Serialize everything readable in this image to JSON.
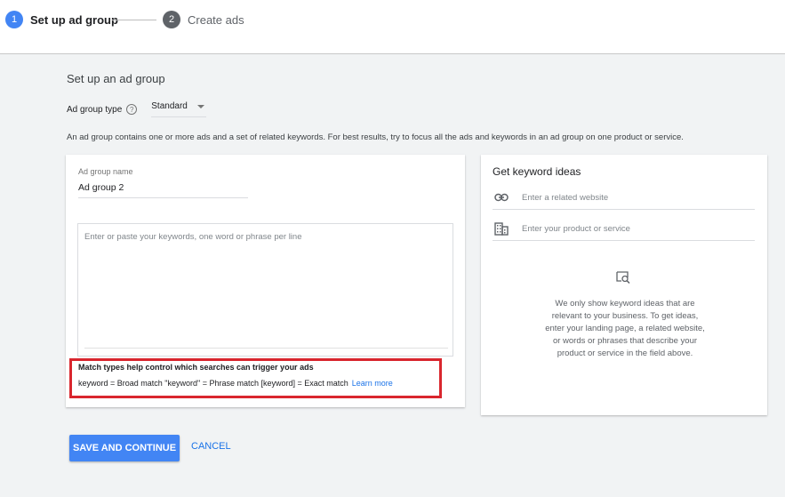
{
  "stepper": {
    "step1": {
      "number": "1",
      "label": "Set up ad group"
    },
    "step2": {
      "number": "2",
      "label": "Create ads"
    }
  },
  "section_title": "Set up an ad group",
  "ad_group_type": {
    "label": "Ad group type",
    "help": "?",
    "value": "Standard"
  },
  "description": "An ad group contains one or more ads and a set of related keywords. For best results, try to focus all the ads and keywords in an ad group on one product or service.",
  "ad_group_name": {
    "label": "Ad group name",
    "value": "Ad group 2"
  },
  "keywords": {
    "placeholder": "Enter or paste your keywords, one word or phrase per line"
  },
  "match_types": {
    "title": "Match types help control which searches can trigger your ads",
    "text": "keyword = Broad match  \"keyword\" = Phrase match  [keyword] = Exact match",
    "link": "Learn more"
  },
  "keyword_ideas": {
    "title": "Get keyword ideas",
    "website_placeholder": "Enter a related website",
    "product_placeholder": "Enter your product or service",
    "info": "We only show keyword ideas that are relevant to your business. To get ideas, enter your landing page, a related website, or words or phrases that describe your product or service in the field above."
  },
  "actions": {
    "save": "SAVE AND CONTINUE",
    "cancel": "CANCEL"
  },
  "colors": {
    "accent": "#4285f4",
    "link": "#1a73e8",
    "highlight_border": "#d9262e"
  },
  "icons": [
    "link-icon",
    "building-icon",
    "search-document-icon",
    "help-icon",
    "dropdown-caret-icon"
  ]
}
